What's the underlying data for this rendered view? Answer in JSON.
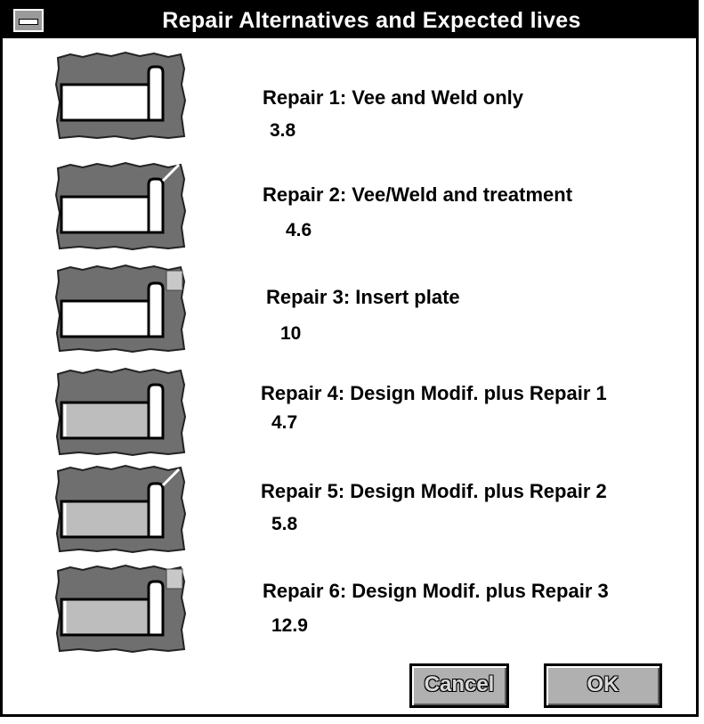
{
  "window": {
    "title": "Repair Alternatives and Expected lives"
  },
  "repairs": [
    {
      "label": "Repair 1: Vee and Weld only",
      "life": "3.8"
    },
    {
      "label": "Repair 2: Vee/Weld and treatment",
      "life": "4.6"
    },
    {
      "label": "Repair 3: Insert plate",
      "life": "10"
    },
    {
      "label": "Repair 4: Design Modif. plus Repair 1",
      "life": "4.7"
    },
    {
      "label": "Repair 5: Design Modif. plus Repair 2",
      "life": "5.8"
    },
    {
      "label": "Repair 6: Design Modif. plus Repair 3",
      "life": "12.9"
    }
  ],
  "buttons": {
    "cancel_label": "Cancel",
    "ok_label": "OK"
  },
  "colors": {
    "titlebar": "#000000",
    "button_face": "#b0b0b0",
    "thumbnail_fill": "#6f6f6f"
  }
}
